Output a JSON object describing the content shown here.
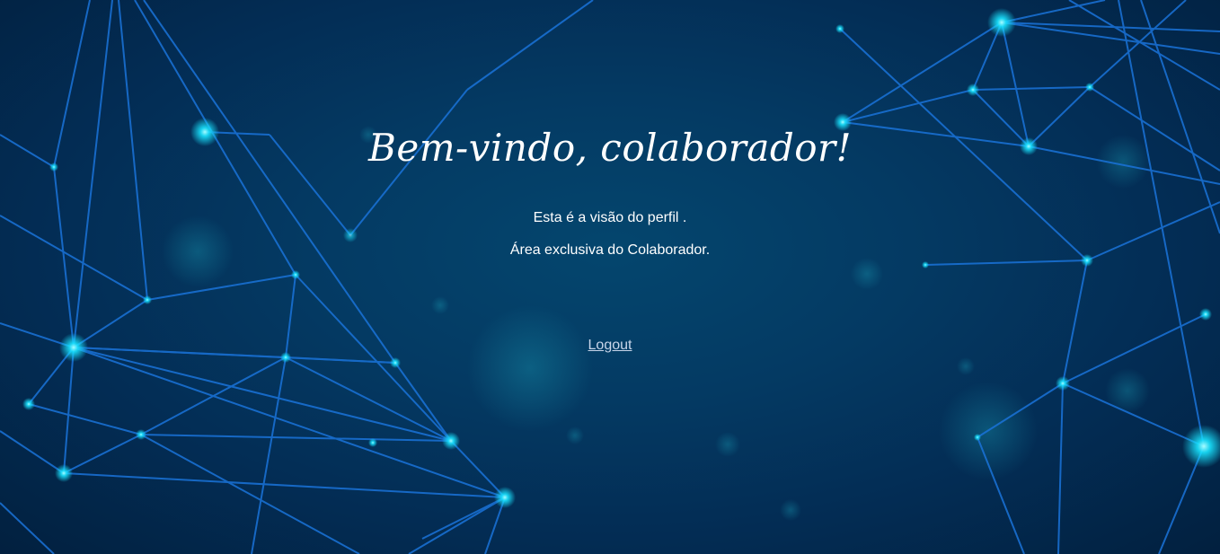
{
  "page": {
    "heading": "Bem-vindo, colaborador!",
    "profile_text": "Esta é a visão do perfil .",
    "area_text": "Área exclusiva do Colaborador.",
    "logout_label": "Logout"
  },
  "colors": {
    "background": "#043a63",
    "network_line": "#1a73d9",
    "node_glow": "#19e3ff",
    "link": "#c9d6ea"
  }
}
